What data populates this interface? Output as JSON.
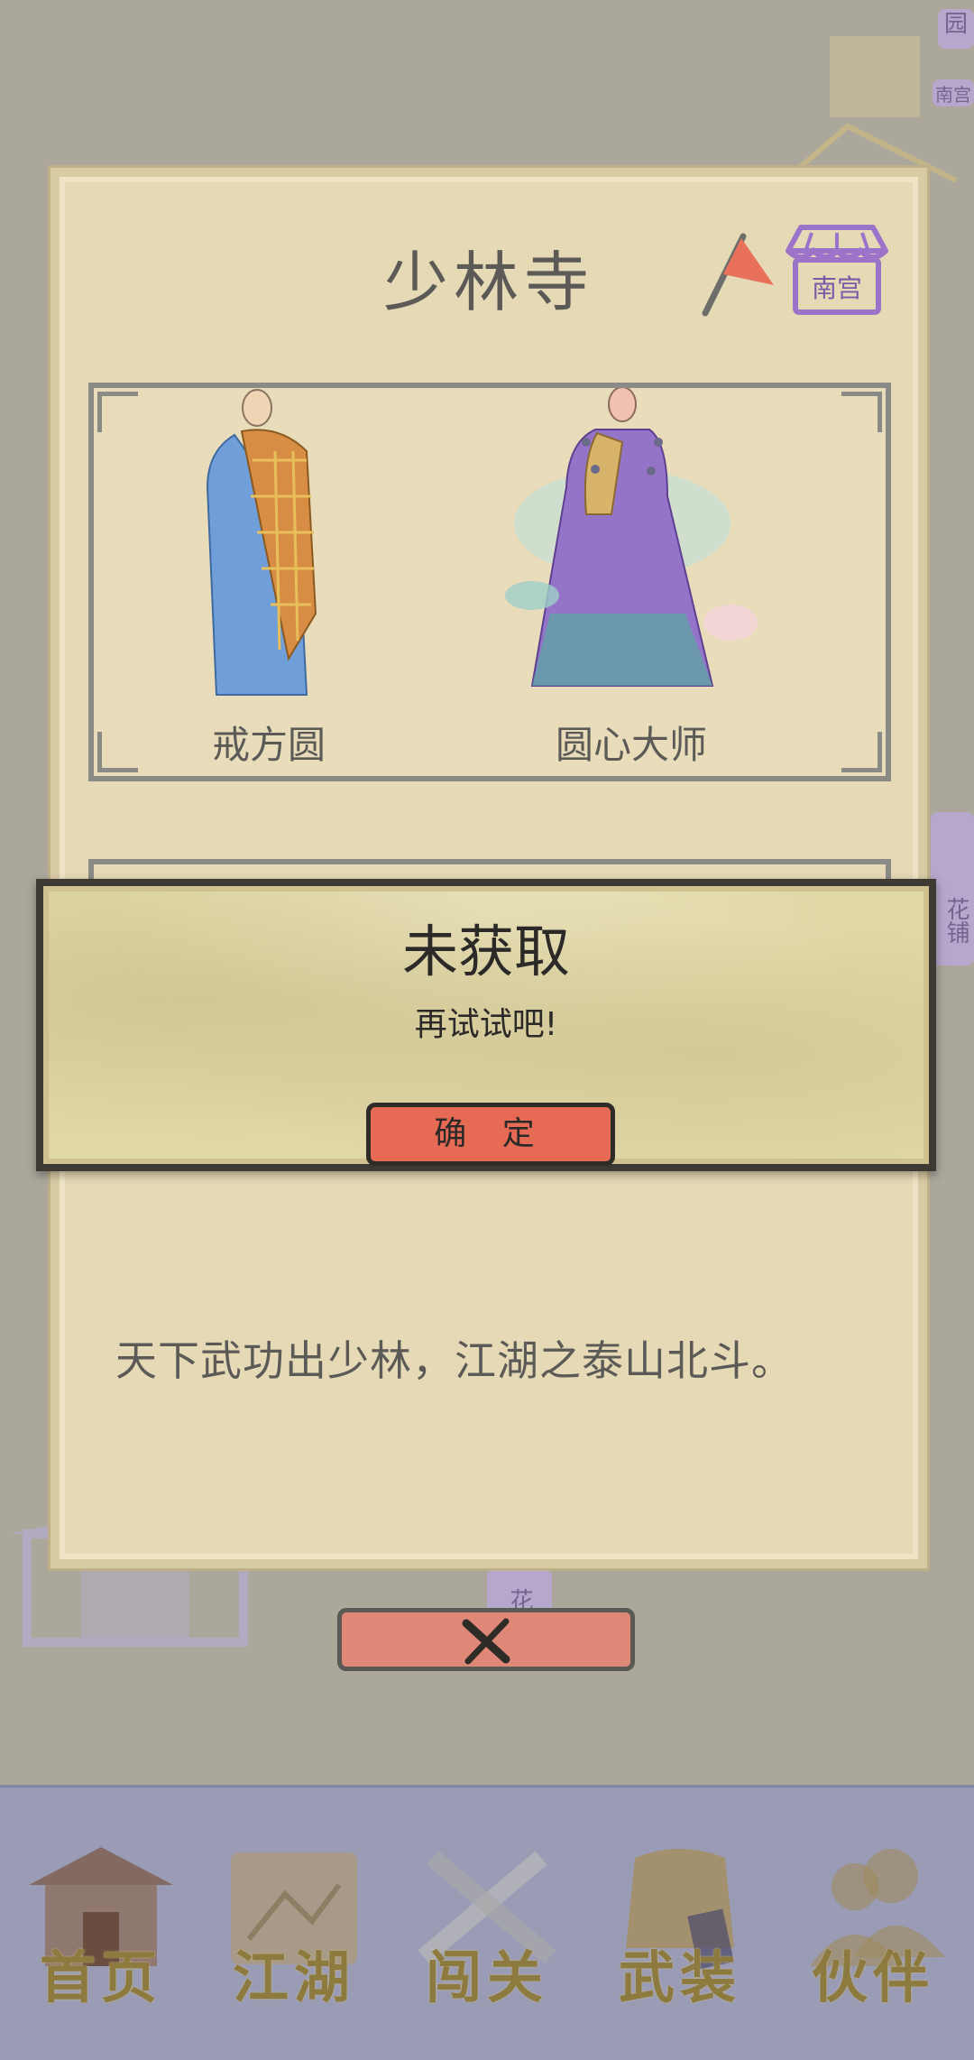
{
  "background": {
    "tags": [
      "园",
      "南宫",
      "花铺",
      "花楼"
    ]
  },
  "panel": {
    "title": "少林寺",
    "shop_label": "南宫",
    "characters": [
      {
        "name": "戒方圆"
      },
      {
        "name": "圆心大师"
      }
    ],
    "motto": "天下武功出少林，江湖之泰山北斗。"
  },
  "popup": {
    "title": "未获取",
    "message": "再试试吧!",
    "confirm_label": "确 定"
  },
  "nav": {
    "items": [
      {
        "label": "首页"
      },
      {
        "label": "江湖"
      },
      {
        "label": "闯关"
      },
      {
        "label": "武装"
      },
      {
        "label": "伙伴"
      }
    ]
  },
  "colors": {
    "panel": "#e6d9b6",
    "accent_red": "#e76a55",
    "nav_bg": "#9a9cb6",
    "nav_text": "#8c7a3f",
    "shop_purple": "#9b73c9"
  }
}
